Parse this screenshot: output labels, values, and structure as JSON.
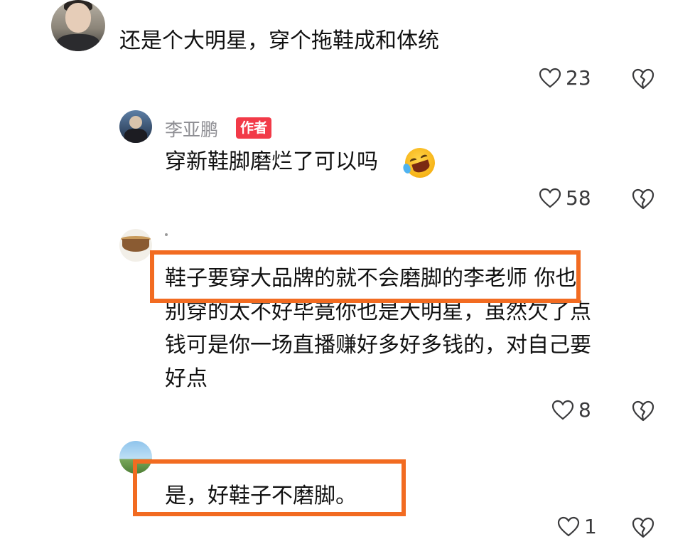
{
  "comments": [
    {
      "text": "还是个大明星，穿个拖鞋成和体统",
      "likes": "23"
    }
  ],
  "reply_author": {
    "name": "李亚鹏",
    "badge": "作者",
    "text": "穿新鞋脚磨烂了可以吗",
    "likes": "58"
  },
  "reply2": {
    "lines": [
      "鞋子要穿大品牌的就不会磨脚的李老师  你也",
      "别穿的太不好毕竟你也是大明星，虽然欠了点",
      "钱可是你一场直播赚好多好多钱的，对自己要",
      "好点"
    ],
    "likes": "8"
  },
  "reply3": {
    "text": "是，好鞋子不磨脚。",
    "likes": "1"
  },
  "colors": {
    "highlight_border": "#f26b21",
    "badge_bg": "#f23a48",
    "username": "#8e8e93"
  },
  "icons": [
    "heart-outline-icon",
    "broken-heart-icon",
    "laugh-cry-emoji-icon"
  ]
}
